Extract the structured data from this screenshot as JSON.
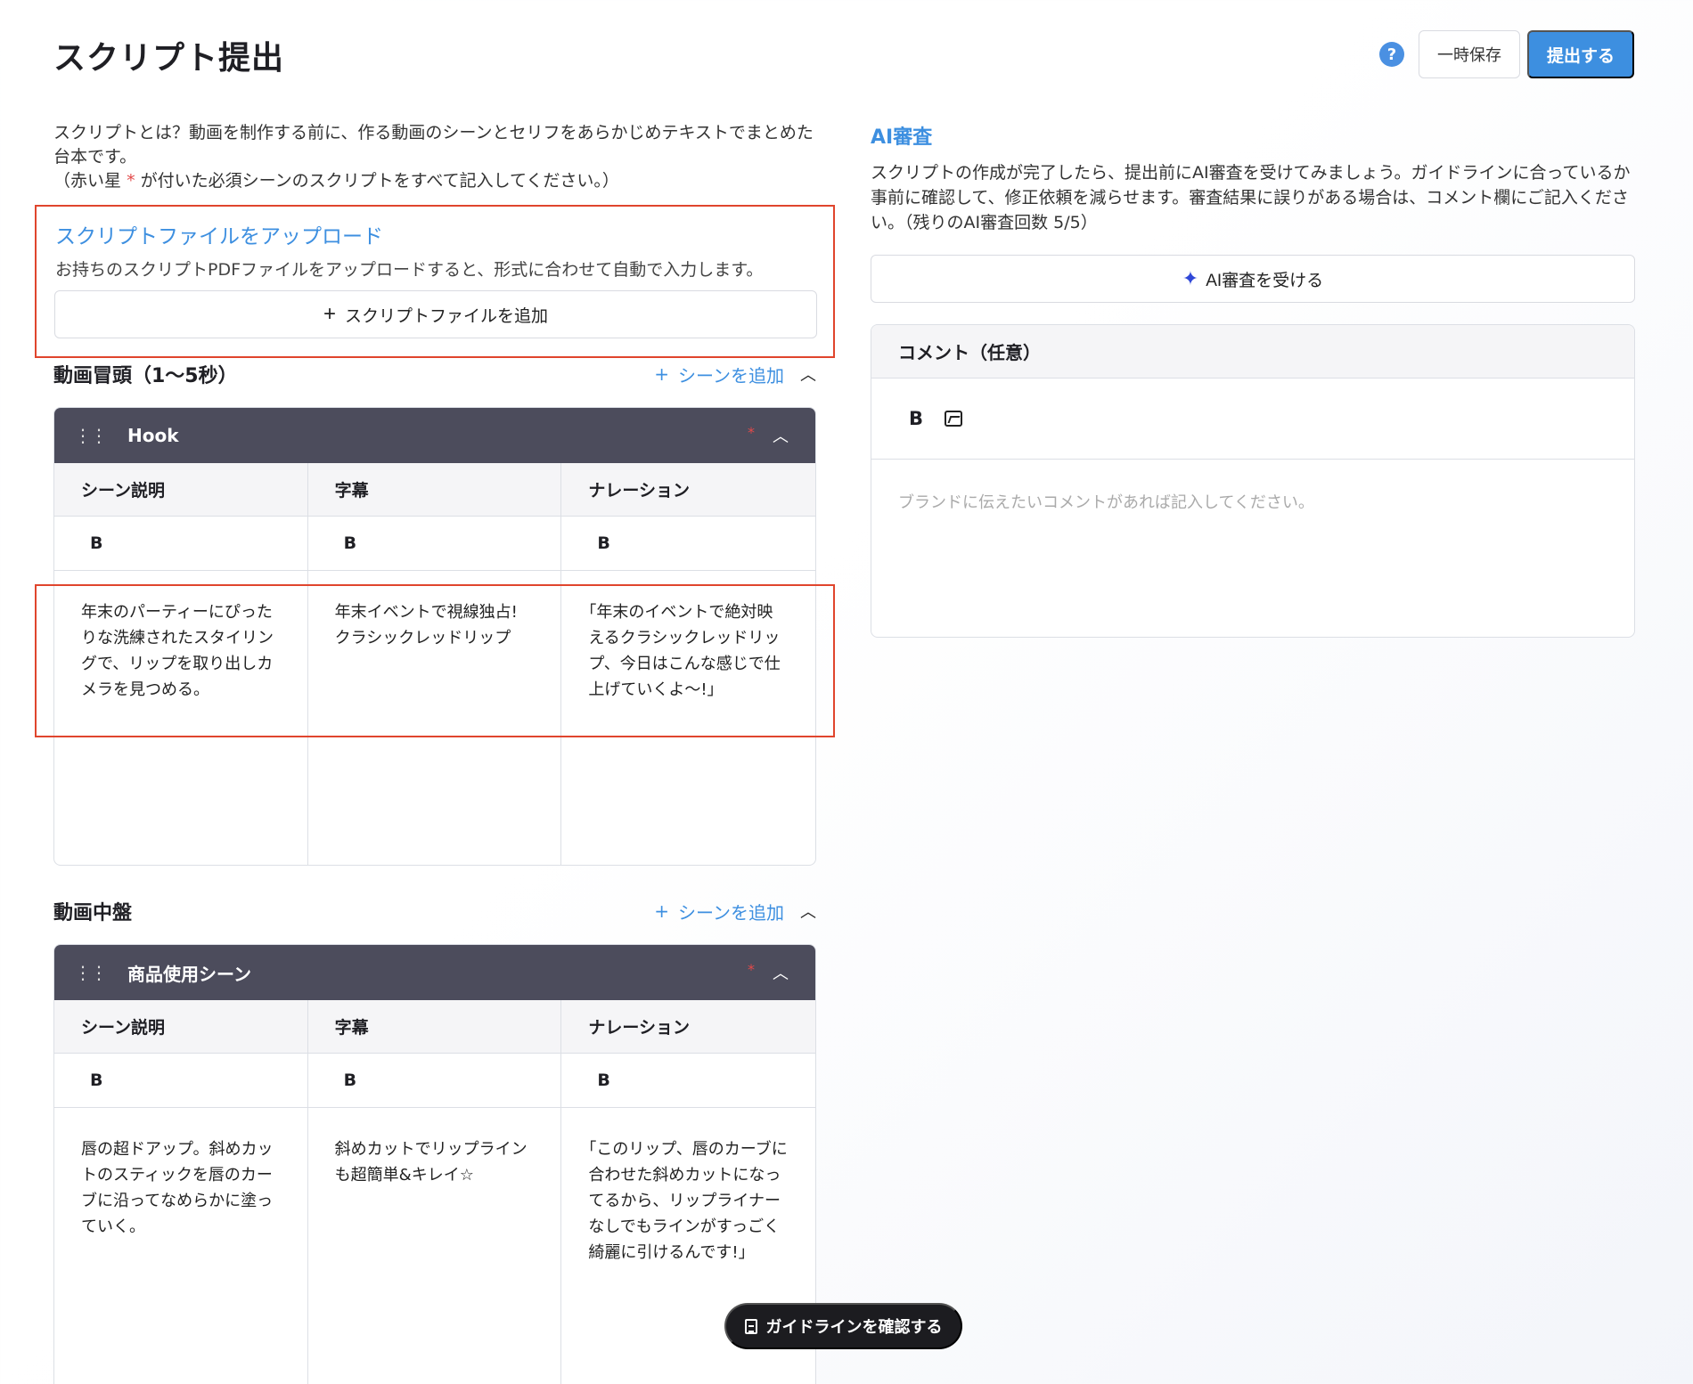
{
  "header": {
    "title": "スクリプト提出",
    "help_icon": "?",
    "save_label": "一時保存",
    "submit_label": "提出する"
  },
  "intro": {
    "line1": "スクリプトとは？動画を制作する前に、作る動画のシーンとセリフをあらかじめテキストでまとめた台本です。",
    "line2_prefix": "（赤い星",
    "line2_star": "*",
    "line2_suffix": "が付いた必須シーンのスクリプトをすべて記入してください。）"
  },
  "upload": {
    "title": "スクリプトファイルをアップロード",
    "description": "お持ちのスクリプトPDFファイルをアップロードすると、形式に合わせて自動で入力します。",
    "button_label": "スクリプトファイルを追加"
  },
  "sections": [
    {
      "title": "動画冒頭（1〜5秒）",
      "add_label": "シーンを追加",
      "scene": {
        "name": "Hook",
        "columns": [
          {
            "header": "シーン説明",
            "tool": "B",
            "body": "年末のパーティーにぴったりな洗練されたスタイリングで、リップを取り出しカメラを見つめる。"
          },
          {
            "header": "字幕",
            "tool": "B",
            "body": "年末イベントで視線独占! クラシックレッドリップ"
          },
          {
            "header": "ナレーション",
            "tool": "B",
            "body": "｢年末のイベントで絶対映えるクラシックレッドリップ、今日はこんな感じで仕上げていくよ〜!｣"
          }
        ]
      }
    },
    {
      "title": "動画中盤",
      "add_label": "シーンを追加",
      "scene": {
        "name": "商品使用シーン",
        "columns": [
          {
            "header": "シーン説明",
            "tool": "B",
            "body": "唇の超ドアップ。斜めカットのスティックを唇のカーブに沿ってなめらかに塗っていく。"
          },
          {
            "header": "字幕",
            "tool": "B",
            "body": "斜めカットでリップラインも超簡単&キレイ☆"
          },
          {
            "header": "ナレーション",
            "tool": "B",
            "body": "｢このリップ、唇のカーブに合わせた斜めカットになってるから、リップライナーなしでもラインがすっごく綺麗に引けるんです!｣"
          }
        ]
      }
    }
  ],
  "ai_review": {
    "title": "AI審査",
    "description": "スクリプトの作成が完了したら、提出前にAI審査を受けてみましょう。ガイドラインに合っているか事前に確認して、修正依頼を減らせます。審査結果に誤りがある場合は、コメント欄にご記入ください。（残りのAI審査回数 5/5）",
    "button_label": "AI審査を受ける"
  },
  "comment": {
    "title": "コメント（任意）",
    "bold_tool": "B",
    "placeholder": "ブランドに伝えたいコメントがあれば記入してください。"
  },
  "guide_button": {
    "label": "ガイドラインを確認する"
  },
  "colors": {
    "accent": "#3d8fe0",
    "scene_header": "#4c4c5c",
    "highlight": "#e0452d",
    "required": "#e24a4a"
  }
}
